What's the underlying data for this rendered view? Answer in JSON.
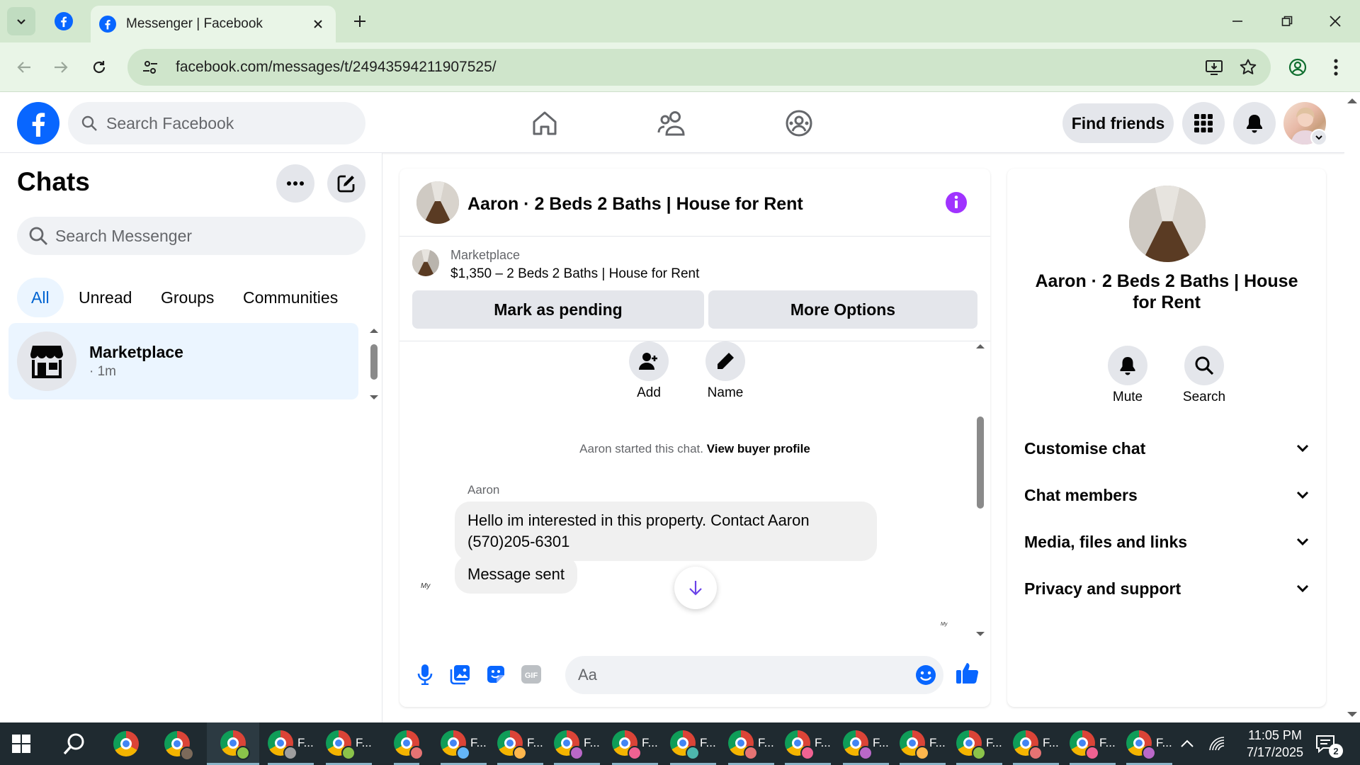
{
  "browser": {
    "tab_title": "Messenger | Facebook",
    "url": "facebook.com/messages/t/24943594211907525/"
  },
  "header": {
    "search_placeholder": "Search Facebook",
    "find_friends": "Find friends"
  },
  "chats": {
    "title": "Chats",
    "search_placeholder": "Search Messenger",
    "filters": [
      "All",
      "Unread",
      "Groups",
      "Communities"
    ],
    "active_filter": "All",
    "items": [
      {
        "name": "Marketplace",
        "meta": "· 1m"
      }
    ]
  },
  "conversation": {
    "title": "Aaron · 2 Beds 2 Baths | House for Rent",
    "listing": {
      "source": "Marketplace",
      "price_title": "$1,350 – 2 Beds 2 Baths | House for Rent",
      "btn_pending": "Mark as pending",
      "btn_more": "More Options"
    },
    "actions": {
      "add": "Add",
      "name": "Name"
    },
    "system": {
      "text": "Aaron started this chat.",
      "link": "View buyer profile"
    },
    "messages": [
      {
        "sender": "Aaron",
        "lines": [
          "Hello im interested in this property. Contact Aaron",
          "(570)205-6301"
        ]
      },
      {
        "text": "Message sent"
      }
    ],
    "seen_label": "My",
    "composer_placeholder": "Aa"
  },
  "info_panel": {
    "name": "Aaron · 2 Beds 2 Baths | House for Rent",
    "actions": {
      "mute": "Mute",
      "search": "Search"
    },
    "sections": [
      "Customise chat",
      "Chat members",
      "Media, files and links",
      "Privacy and support"
    ]
  },
  "taskbar": {
    "label": "F...",
    "time": "11:05 PM",
    "date": "7/17/2025",
    "notifications": "2"
  },
  "colors": {
    "fb_blue": "#0866ff",
    "messenger_purple": "#a033ff",
    "active_filter_bg": "#ebf5ff",
    "chrome_toolbar": "#e9f5e7"
  }
}
